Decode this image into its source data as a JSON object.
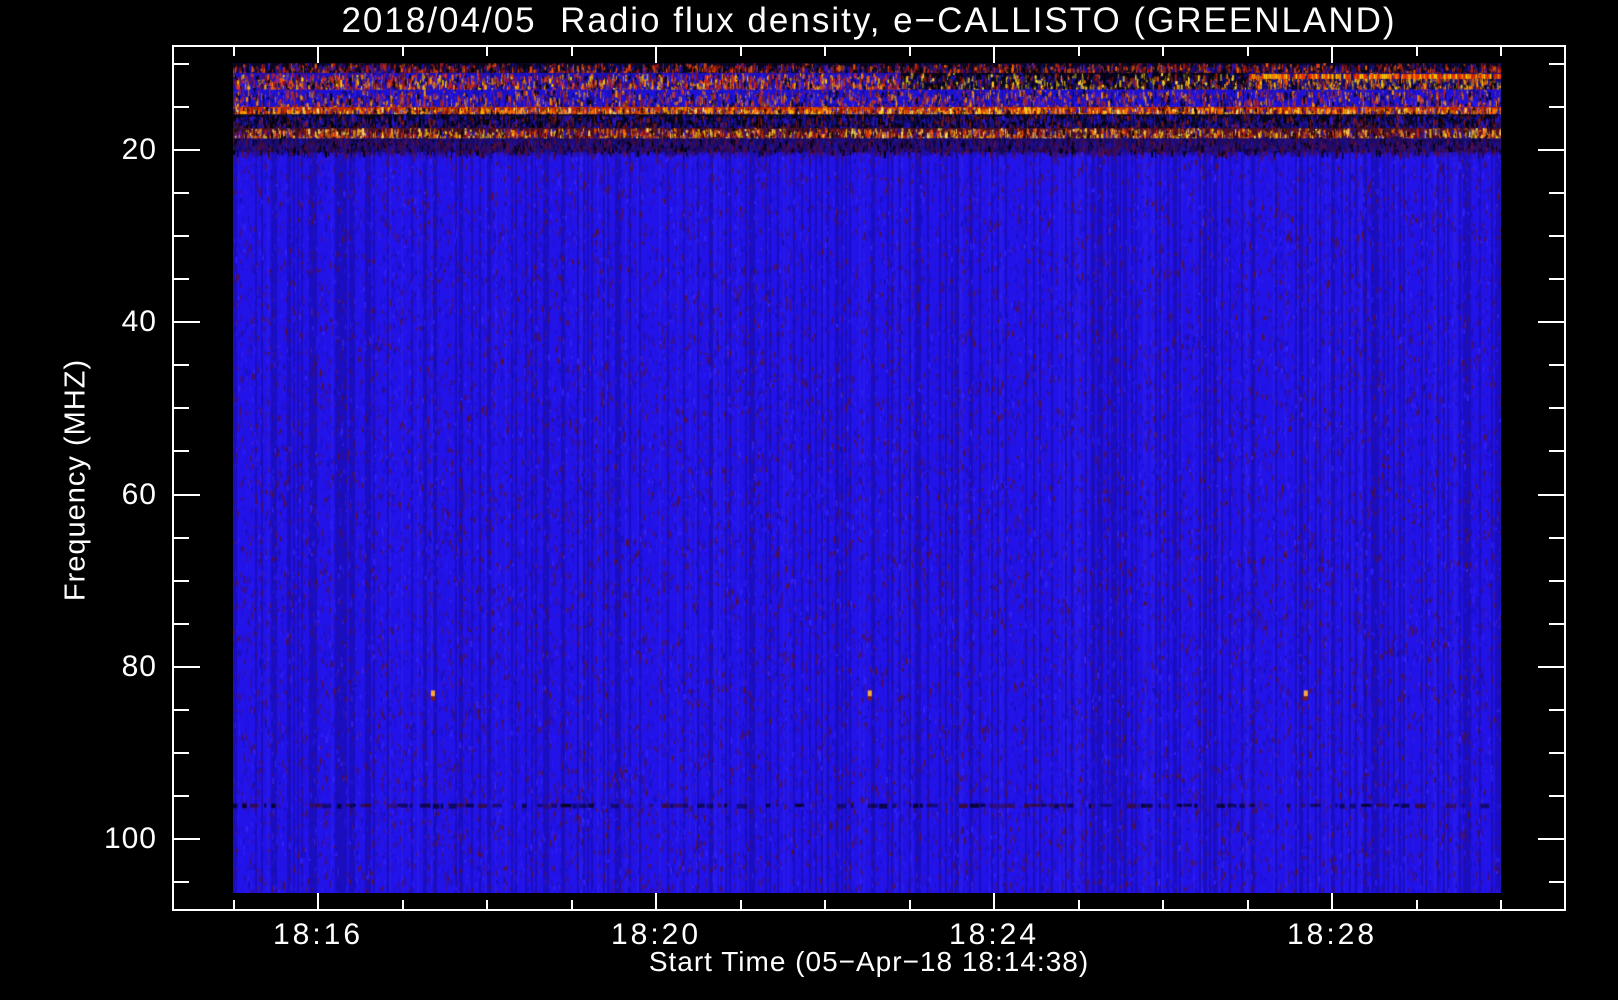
{
  "window": {
    "background": "#000000",
    "frame_color": "#ffffff",
    "text_color": "#ffffff"
  },
  "chart_data": {
    "type": "heatmap",
    "subtype": "radio-spectrogram",
    "title": "2018/04/05  Radio flux density, e−CALLISTO (GREENLAND)",
    "xlabel": "Start Time (05−Apr−18 18:14:38)",
    "ylabel": "Frequency (MHZ)",
    "legend": "none",
    "grid": "off",
    "x_axis": {
      "unit": "minutes after 18:00 UT",
      "domain": [
        14.27,
        30.77
      ],
      "major_ticks": [
        {
          "t": 16,
          "label": "18:16"
        },
        {
          "t": 20,
          "label": "18:20"
        },
        {
          "t": 24,
          "label": "18:24"
        },
        {
          "t": 28,
          "label": "18:28"
        }
      ],
      "minor_tick_minutes": [
        15,
        17,
        18,
        19,
        21,
        22,
        23,
        25,
        26,
        27,
        29,
        30
      ]
    },
    "y_axis": {
      "unit": "MHz",
      "inverted": true,
      "domain": [
        7.8,
        108.4
      ],
      "major_ticks": [
        {
          "mhz": 20,
          "label": "20"
        },
        {
          "mhz": 40,
          "label": "40"
        },
        {
          "mhz": 60,
          "label": "60"
        },
        {
          "mhz": 80,
          "label": "80"
        },
        {
          "mhz": 100,
          "label": "100"
        }
      ],
      "minor_tick_mhz": [
        10,
        15,
        25,
        30,
        35,
        45,
        50,
        55,
        65,
        70,
        75,
        85,
        90,
        95,
        105
      ]
    },
    "data_extent": {
      "t_start_min": 15.0,
      "t_end_min": 30.0,
      "f_top_mhz": 9.9,
      "f_bottom_mhz": 106.1
    },
    "noise_floor": {
      "base": "#2213e9",
      "streaks": [
        "#170fb2",
        "#1d12cc",
        "#3424ff",
        "#4b0f55",
        "#5a1228",
        "#2a1ae2"
      ],
      "col_dark": "rgba(0,0,40,0.22)",
      "col_light": "rgba(90,90,255,0.10)",
      "speck_red": "#6b1430"
    },
    "rfi_bands": [
      {
        "f0": 9.9,
        "f1": 11.05,
        "style": "speckle",
        "base": "#0a0620",
        "colors": [
          "#cc2211",
          "#881111",
          "#000000",
          "#2214d0",
          "#141077",
          "#ff6600"
        ],
        "density": 0.55
      },
      {
        "f0": 11.05,
        "f1": 13.0,
        "style": "segmented",
        "segments": [
          {
            "t0": 15.0,
            "t1": 22.9,
            "base": "#1a10c0",
            "density": 0.5,
            "colors": [
              "#cc2211",
              "#ee3311",
              "#ff7700",
              "#ffcc00",
              "#000000",
              "#2c1bee",
              "#7a1020"
            ]
          },
          {
            "t0": 22.9,
            "t1": 27.0,
            "base": "#060418",
            "density": 0.45,
            "bright_rare": true,
            "colors": [
              "#16107e",
              "#2215cc",
              "#000000",
              "#aa2211",
              "#ffdd22"
            ]
          },
          {
            "t0": 27.0,
            "t1": 30.0,
            "base": "#140c80",
            "density": 0.5,
            "topline": true,
            "colors": [
              "#dd3300",
              "#ff8800",
              "#ffcc00",
              "#16107e",
              "#000000"
            ]
          }
        ]
      },
      {
        "f0": 13.0,
        "f1": 15.0,
        "style": "speckle",
        "base": "#1c11d6",
        "colors": [
          "#aa2211",
          "#cc3322",
          "#000000",
          "#150e9e",
          "#2c1bf2",
          "#ff9900"
        ],
        "density": 0.35
      },
      {
        "f0": 15.0,
        "f1": 15.85,
        "style": "hotline",
        "base": "#c22800",
        "colors": [
          "#ff5500",
          "#ff8800",
          "#ffcc00",
          "#ffee88",
          "#8a0f00",
          "#000000",
          "#2214d0"
        ],
        "density": 0.85
      },
      {
        "f0": 15.85,
        "f1": 17.45,
        "style": "darkstreaks",
        "base": "#07051f",
        "colors": [
          "#141080",
          "#1c12b0",
          "#000000",
          "#2a18d8",
          "#8a1a11"
        ],
        "density": 0.5
      },
      {
        "f0": 17.45,
        "f1": 18.65,
        "style": "hotline",
        "base": "#47102a",
        "colors": [
          "#cc2211",
          "#ff6600",
          "#ffcc00",
          "#ffe066",
          "#000000",
          "#2315c0",
          "#7a1020"
        ],
        "density": 0.6
      },
      {
        "f0": 18.65,
        "f1": 20.25,
        "style": "speckle",
        "base": "#170b66",
        "colors": [
          "#4a0d35",
          "#5c1040",
          "#2a0a70",
          "#1a10b0",
          "#000000",
          "#221498"
        ],
        "density": 0.6
      }
    ],
    "interference_line": {
      "f": 95.9,
      "color": "#000000",
      "accent": "#3c0a18"
    },
    "calibration_dots": {
      "f": 83.1,
      "times": [
        17.36,
        22.53,
        27.69
      ],
      "top_color": "#ffaa33",
      "bottom_color": "#7a1a11"
    }
  }
}
